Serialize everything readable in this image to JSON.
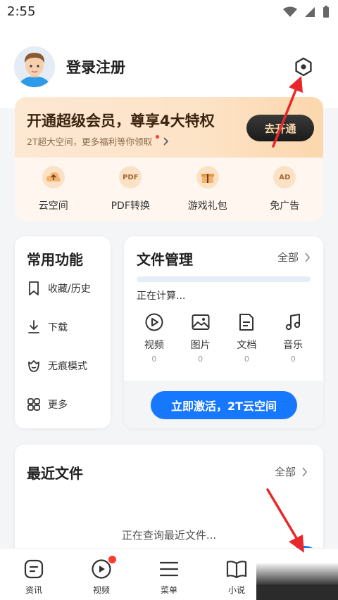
{
  "status_bar": {
    "time": "2:55"
  },
  "profile": {
    "login_label": "登录注册"
  },
  "vip": {
    "title": "开通超级会员，尊享4大特权",
    "subtitle": "2T超大空间，更多福利等你领取",
    "button": "去开通",
    "items": [
      {
        "label": "云空间",
        "icon": "cloud-upload-icon"
      },
      {
        "label": "PDF转换",
        "icon": "pdf-icon",
        "badge": "PDF"
      },
      {
        "label": "游戏礼包",
        "icon": "gift-icon"
      },
      {
        "label": "免广告",
        "icon": "ad-icon",
        "badge": "AD"
      }
    ]
  },
  "common": {
    "title": "常用功能",
    "items": [
      {
        "label": "收藏/历史",
        "icon": "bookmark-icon"
      },
      {
        "label": "下载",
        "icon": "download-icon"
      },
      {
        "label": "无痕模式",
        "icon": "incognito-icon"
      },
      {
        "label": "更多",
        "icon": "grid-icon"
      }
    ]
  },
  "files": {
    "title": "文件管理",
    "all": "全部",
    "status": "正在计算...",
    "categories": [
      {
        "label": "视频",
        "count": "0",
        "icon": "video-icon"
      },
      {
        "label": "图片",
        "count": "0",
        "icon": "image-icon"
      },
      {
        "label": "文档",
        "count": "0",
        "icon": "document-icon"
      },
      {
        "label": "音乐",
        "count": "0",
        "icon": "music-icon"
      }
    ],
    "activate": "立即激活，2T云空间"
  },
  "recent": {
    "title": "最近文件",
    "all": "全部",
    "loading": "正在查询最近文件..."
  },
  "tabbar": [
    {
      "label": "资讯",
      "icon": "news-icon"
    },
    {
      "label": "视频",
      "icon": "play-icon"
    },
    {
      "label": "菜单",
      "icon": "menu-icon"
    },
    {
      "label": "小说",
      "icon": "book-icon"
    }
  ],
  "colors": {
    "accent": "#1677ff",
    "arrow": "#e8272a",
    "vip_bg": "#fde3c7"
  }
}
